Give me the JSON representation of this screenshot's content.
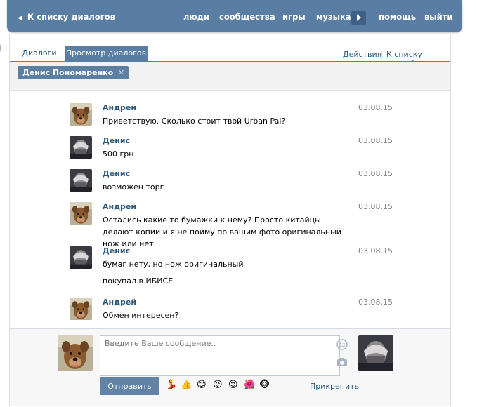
{
  "topbar": {
    "back_label": "К списку диалогов",
    "nav": [
      {
        "label": "люди"
      },
      {
        "label": "сообщества"
      },
      {
        "label": "игры"
      },
      {
        "label": "музыка"
      },
      {
        "label": "помощь"
      },
      {
        "label": "выйти"
      }
    ]
  },
  "tabs": {
    "dialogs": "Диалоги",
    "view": "Просмотр диалогов",
    "actions": "Действия",
    "separator": "|",
    "friends": "К списку друзей"
  },
  "chip": {
    "name": "Денис Пономаренко",
    "close": "✕"
  },
  "messages": [
    {
      "name": "Андрей",
      "date": "03.08.15",
      "text": "Приветствую. Сколько стоит твой Urban Pal?",
      "avatar": "dog-avatar"
    },
    {
      "name": "Денис",
      "date": "03.08.15",
      "text": "500 грн",
      "avatar": "person-avatar"
    },
    {
      "name": "Денис",
      "date": "03.08.15",
      "text": "возможен торг",
      "avatar": "person-avatar"
    },
    {
      "name": "Андрей",
      "date": "03.08.15",
      "text": "Остались какие то бумажки к нему? Просто китайцы делают копии и я не пойму по вашим фото оригинальный нож или нет.",
      "avatar": "dog-avatar"
    },
    {
      "name": "Денис",
      "date": "03.08.15",
      "text": "бумаг нету, но нож оригинальный",
      "text2": "покупал в ИБИСЕ",
      "avatar": "person-avatar"
    },
    {
      "name": "Андрей",
      "date": "03.08.15",
      "text": "Обмен интересен?",
      "avatar": "dog-avatar"
    }
  ],
  "composer": {
    "placeholder": "Введите Ваше сообщение..",
    "send_label": "Отправить",
    "attach_label": "Прикрепить",
    "emojis": [
      "💃",
      "👍",
      "😊",
      "😜",
      "😉",
      "🌺",
      "🐵"
    ]
  },
  "colors": {
    "brand": "#597da3",
    "link": "#2b587a"
  }
}
